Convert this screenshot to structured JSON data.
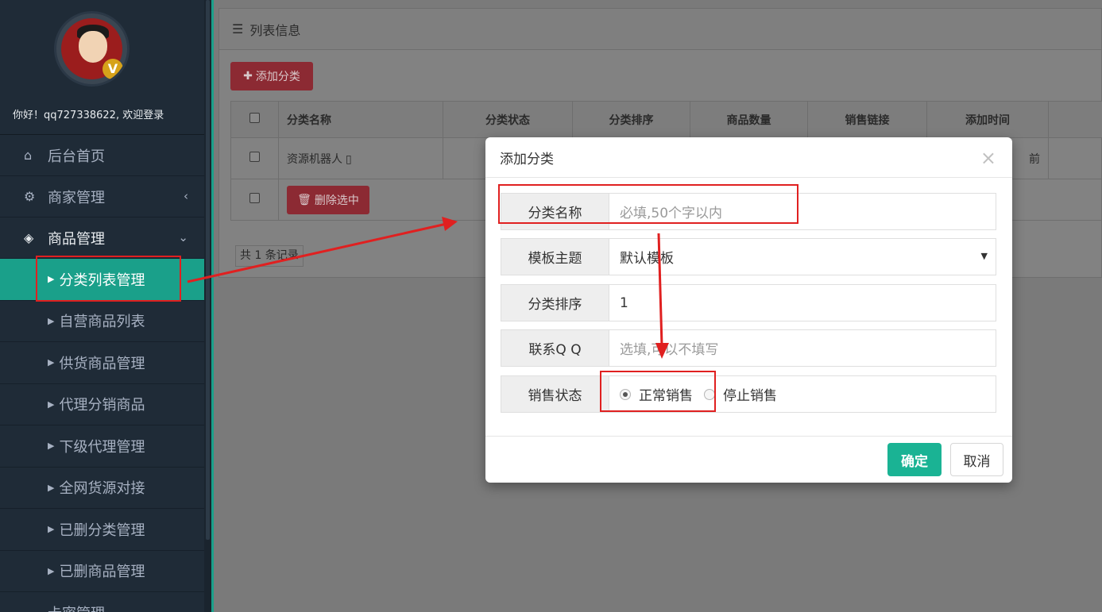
{
  "sidebar": {
    "welcome": "你好！qq727338622, 欢迎登录",
    "avatar_badge": "V",
    "menu": [
      {
        "label": "后台首页",
        "icon": "home-icon"
      },
      {
        "label": "商家管理",
        "icon": "gears-icon"
      },
      {
        "label": "商品管理",
        "icon": "cubes-icon"
      }
    ],
    "submenu": [
      {
        "label": "分类列表管理",
        "active": true
      },
      {
        "label": "自营商品列表"
      },
      {
        "label": "供货商品管理"
      },
      {
        "label": "代理分销商品"
      },
      {
        "label": "下级代理管理"
      },
      {
        "label": "全网货源对接"
      },
      {
        "label": "已删分类管理"
      },
      {
        "label": "已删商品管理"
      }
    ],
    "bottom_item": {
      "label": "卡密管理",
      "icon": "credit-card-icon"
    }
  },
  "panel": {
    "title": "列表信息",
    "add_button": "添加分类",
    "columns": [
      "分类名称",
      "分类状态",
      "分类排序",
      "商品数量",
      "销售链接",
      "添加时间"
    ],
    "rows": [
      {
        "name": "资源机器人",
        "time_partial": "前"
      }
    ],
    "delete_button": "删除选中",
    "records": "共 1 条记录"
  },
  "modal": {
    "title": "添加分类",
    "close": "×",
    "fields": {
      "name_label": "分类名称",
      "name_placeholder": "必填,50个字以内",
      "theme_label": "模板主题",
      "theme_value": "默认模板",
      "order_label": "分类排序",
      "order_value": "1",
      "qq_label": "联系Q Q",
      "qq_placeholder": "选填,可以不填写",
      "status_label": "销售状态",
      "status_options": [
        "正常销售",
        "停止销售"
      ],
      "status_selected": "正常销售"
    },
    "ok_button": "确定",
    "cancel_button": "取消"
  },
  "colors": {
    "sidebar_bg": "#1f2b37",
    "accent_teal": "#1ab394",
    "danger": "#ed5565",
    "annotation_red": "#e02020"
  }
}
